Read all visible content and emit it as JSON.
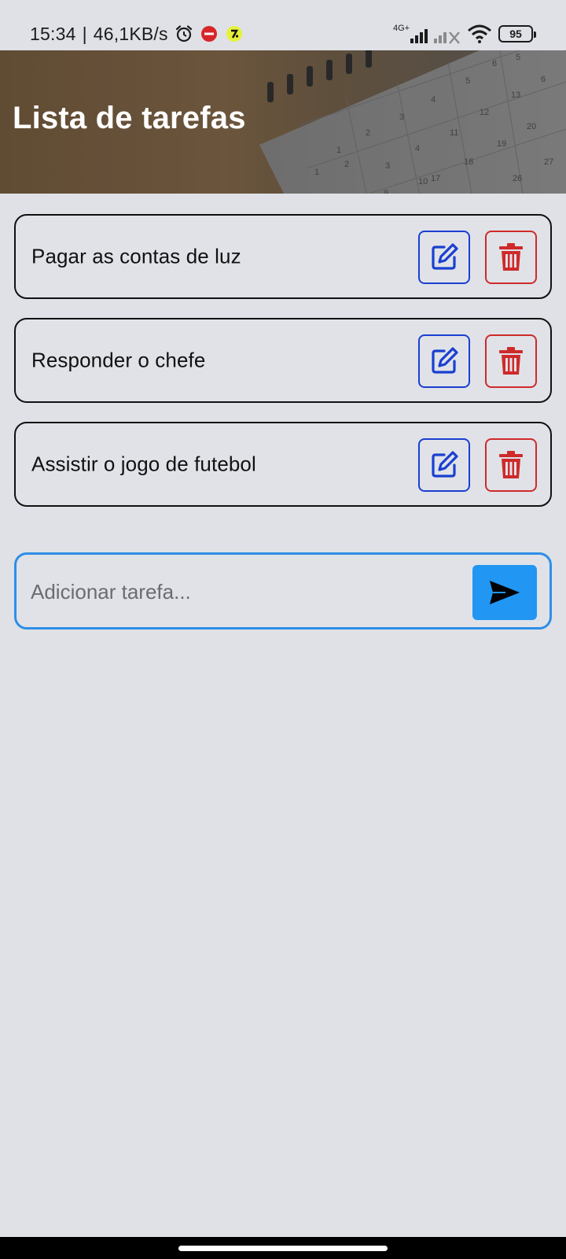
{
  "status_bar": {
    "time": "15:34",
    "separator": "|",
    "net_speed": "46,1KB/s",
    "network_type": "4G+",
    "battery_level": "95",
    "icons": [
      "alarm-icon",
      "red-app-notification-icon",
      "yellow-app-notification-icon",
      "signal-icon",
      "signal-no-service-icon",
      "wifi-icon",
      "battery-icon"
    ]
  },
  "header": {
    "title": "Lista de tarefas",
    "calendar_numbers": [
      "5",
      "6",
      "1",
      "2",
      "3",
      "4",
      "5",
      "6",
      "1",
      "2",
      "3",
      "4",
      "9",
      "10",
      "11",
      "12",
      "13",
      "8",
      "9",
      "17",
      "18",
      "19",
      "20",
      "26",
      "27"
    ]
  },
  "tasks": [
    {
      "text": "Pagar as contas de luz"
    },
    {
      "text": "Responder o chefe"
    },
    {
      "text": "Assistir o jogo de futebol"
    }
  ],
  "add_task": {
    "placeholder": "Adicionar tarefa...",
    "value": ""
  },
  "colors": {
    "background": "#dfe1e6",
    "edit_accent": "#1a3fd1",
    "delete_accent": "#cf2a2a",
    "input_border": "#2e8ee6",
    "send_button": "#2196f3"
  }
}
